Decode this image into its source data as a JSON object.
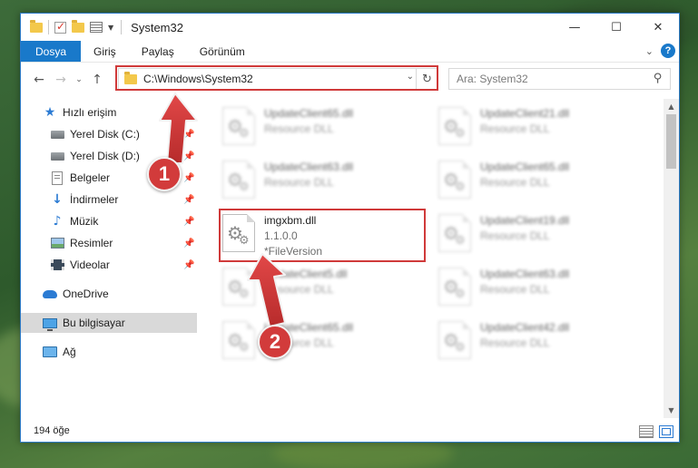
{
  "window": {
    "title": "System32",
    "controls": {
      "minimize": "—",
      "maximize": "☐",
      "close": "✕"
    }
  },
  "ribbon": {
    "tabs": [
      "Dosya",
      "Giriş",
      "Paylaş",
      "Görünüm"
    ],
    "help": "?"
  },
  "navigation": {
    "address": "C:\\Windows\\System32",
    "search_placeholder": "Ara: System32"
  },
  "sidebar": {
    "quick_access": "Hızlı erişim",
    "items": [
      {
        "label": "Yerel Disk (C:)",
        "icon": "drive-icon"
      },
      {
        "label": "Yerel Disk (D:)",
        "icon": "drive-icon"
      },
      {
        "label": "Belgeler",
        "icon": "documents-icon"
      },
      {
        "label": "İndirmeler",
        "icon": "downloads-icon"
      },
      {
        "label": "Müzik",
        "icon": "music-icon"
      },
      {
        "label": "Resimler",
        "icon": "pictures-icon"
      },
      {
        "label": "Videolar",
        "icon": "videos-icon"
      }
    ],
    "onedrive": "OneDrive",
    "this_pc": "Bu bilgisayar",
    "network": "Ağ"
  },
  "files": {
    "left_column": [
      {
        "name": "UpdateClient65.dll",
        "sub": "Resource DLL"
      },
      {
        "name": "UpdateClient63.dll",
        "sub": "Resource DLL"
      },
      {
        "name": "imgxbm.dll",
        "version": "1.1.0.0",
        "sub": "*FileVersion"
      },
      {
        "name": "UpdateClient5.dll",
        "sub": "Resource DLL"
      },
      {
        "name": "UpdateClient65.dll",
        "sub": "Resource DLL"
      }
    ],
    "right_column": [
      {
        "name": "UpdateClient21.dll",
        "sub": "Resource DLL"
      },
      {
        "name": "UpdateClient65.dll",
        "sub": "Resource DLL"
      },
      {
        "name": "UpdateClient19.dll",
        "sub": "Resource DLL"
      },
      {
        "name": "UpdateClient63.dll",
        "sub": "Resource DLL"
      },
      {
        "name": "UpdateClient42.dll",
        "sub": "Resource DLL"
      }
    ]
  },
  "status": {
    "item_count": "194 öğe"
  },
  "annotations": {
    "step1": "1",
    "step2": "2",
    "highlight_color": "#d03a3a"
  }
}
